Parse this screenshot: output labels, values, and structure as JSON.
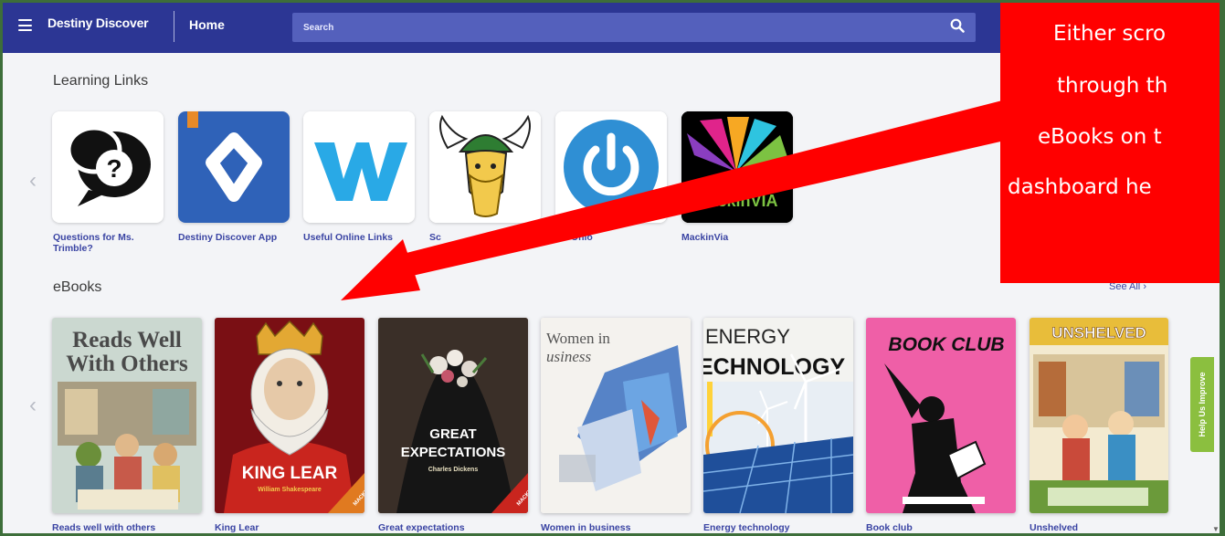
{
  "header": {
    "brand": "Destiny Discover",
    "home_label": "Home",
    "search_placeholder": "Search"
  },
  "learning_links": {
    "title": "Learning Links",
    "items": [
      {
        "label": "Questions for Ms. Trimble?",
        "icon": "speech-bubbles-question-icon"
      },
      {
        "label": "Destiny Discover App",
        "icon": "destiny-app-icon"
      },
      {
        "label": "Useful Online Links",
        "icon": "w-logo-icon"
      },
      {
        "label": "Sc",
        "icon": "viking-mascot-icon"
      },
      {
        "label": "INFOhio",
        "icon": "power-button-icon"
      },
      {
        "label": "MackinVia",
        "icon": "mackinvia-logo",
        "logo_text": "MackinVIA"
      }
    ]
  },
  "ebooks": {
    "title": "eBooks",
    "see_all": "See All",
    "items": [
      {
        "label": "Reads well with others",
        "cover_title_1": "Reads Well",
        "cover_title_2": "With Others"
      },
      {
        "label": "King Lear",
        "cover_title": "KING LEAR",
        "cover_author": "William Shakespeare",
        "cover_badge": "MACKIN"
      },
      {
        "label": "Great expectations",
        "cover_title_1": "GREAT",
        "cover_title_2": "EXPECTATIONS",
        "cover_author": "Charles Dickens",
        "cover_badge": "MACKIN"
      },
      {
        "label": "Women in business",
        "cover_title_1": "Women in",
        "cover_title_2": "usiness"
      },
      {
        "label": "Energy technology",
        "cover_title_1": "ENERGY",
        "cover_title_2": "ECHNOLOGY"
      },
      {
        "label": "Book club",
        "cover_title": "BOOK CLUB"
      },
      {
        "label": "Unshelved",
        "cover_title": "UNSHELVED"
      }
    ]
  },
  "help_tab": "Help Us Improve",
  "callout": {
    "lines": [
      "Either scro",
      "through th",
      "eBooks on t",
      "dashboard he"
    ]
  },
  "colors": {
    "header_bg": "#2c3694",
    "search_bg": "#5460bc",
    "link": "#3a44a3",
    "callout": "#ff0000",
    "help_tab": "#8bbf3f"
  }
}
